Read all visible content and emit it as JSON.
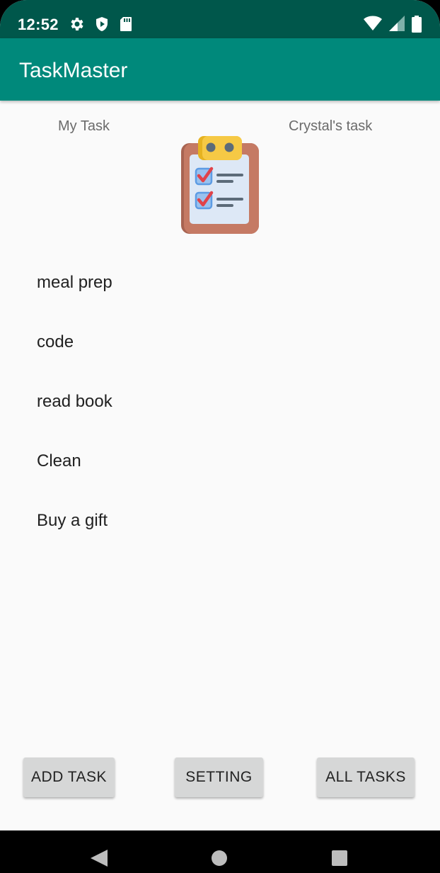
{
  "status_bar": {
    "time": "12:52",
    "icons": [
      "settings-gear-icon",
      "shield-play-icon",
      "sd-card-icon",
      "wifi-icon",
      "signal-icon",
      "battery-icon"
    ]
  },
  "app_bar": {
    "title": "TaskMaster",
    "color": "#00897b",
    "status_color": "#00574b"
  },
  "header": {
    "left_label": "My Task",
    "right_label": "Crystal's task",
    "image_icon": "clipboard-checklist-icon"
  },
  "tasks": [
    "meal prep",
    "code",
    "read book",
    "Clean",
    "Buy a gift"
  ],
  "buttons": {
    "add_task": "ADD TASK",
    "setting": "SETTING",
    "all_tasks": "ALL TASKS"
  },
  "nav_bar": {
    "icons": [
      "back-icon",
      "home-icon",
      "recents-icon"
    ]
  }
}
